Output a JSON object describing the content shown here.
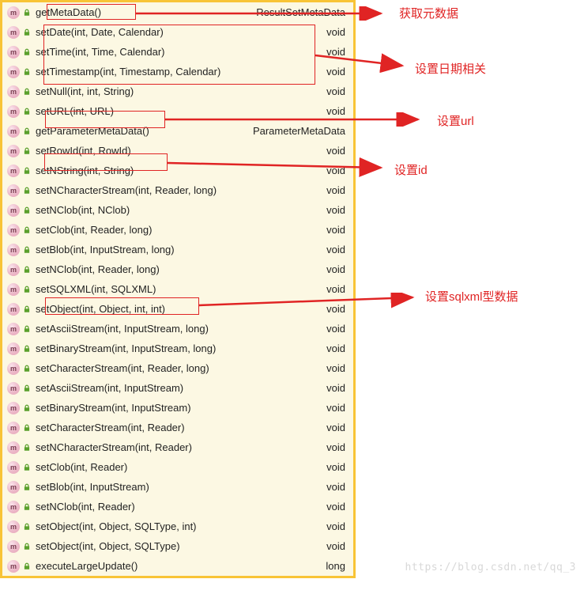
{
  "icon_letter": "m",
  "methods": [
    {
      "name": "getMetaData()",
      "ret": "ResultSetMetaData"
    },
    {
      "name": "setDate(int, Date, Calendar)",
      "ret": "void"
    },
    {
      "name": "setTime(int, Time, Calendar)",
      "ret": "void"
    },
    {
      "name": "setTimestamp(int, Timestamp, Calendar)",
      "ret": "void"
    },
    {
      "name": "setNull(int, int, String)",
      "ret": "void"
    },
    {
      "name": "setURL(int, URL)",
      "ret": "void"
    },
    {
      "name": "getParameterMetaData()",
      "ret": "ParameterMetaData"
    },
    {
      "name": "setRowId(int, RowId)",
      "ret": "void"
    },
    {
      "name": "setNString(int, String)",
      "ret": "void"
    },
    {
      "name": "setNCharacterStream(int, Reader, long)",
      "ret": "void"
    },
    {
      "name": "setNClob(int, NClob)",
      "ret": "void"
    },
    {
      "name": "setClob(int, Reader, long)",
      "ret": "void"
    },
    {
      "name": "setBlob(int, InputStream, long)",
      "ret": "void"
    },
    {
      "name": "setNClob(int, Reader, long)",
      "ret": "void"
    },
    {
      "name": "setSQLXML(int, SQLXML)",
      "ret": "void"
    },
    {
      "name": "setObject(int, Object, int, int)",
      "ret": "void"
    },
    {
      "name": "setAsciiStream(int, InputStream, long)",
      "ret": "void"
    },
    {
      "name": "setBinaryStream(int, InputStream, long)",
      "ret": "void"
    },
    {
      "name": "setCharacterStream(int, Reader, long)",
      "ret": "void"
    },
    {
      "name": "setAsciiStream(int, InputStream)",
      "ret": "void"
    },
    {
      "name": "setBinaryStream(int, InputStream)",
      "ret": "void"
    },
    {
      "name": "setCharacterStream(int, Reader)",
      "ret": "void"
    },
    {
      "name": "setNCharacterStream(int, Reader)",
      "ret": "void"
    },
    {
      "name": "setClob(int, Reader)",
      "ret": "void"
    },
    {
      "name": "setBlob(int, InputStream)",
      "ret": "void"
    },
    {
      "name": "setNClob(int, Reader)",
      "ret": "void"
    },
    {
      "name": "setObject(int, Object, SQLType, int)",
      "ret": "void"
    },
    {
      "name": "setObject(int, Object, SQLType)",
      "ret": "void"
    },
    {
      "name": "executeLargeUpdate()",
      "ret": "long"
    }
  ],
  "annotations": {
    "a0": "获取元数据",
    "a1": "设置日期相关",
    "a2": "设置url",
    "a3": "设置id",
    "a4": "设置sqlxml型数据"
  },
  "watermark": "https://blog.csdn.net/qq_3"
}
